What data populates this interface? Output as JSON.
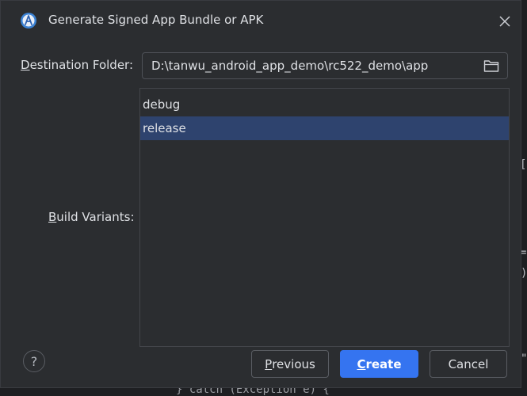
{
  "dialog": {
    "title": "Generate Signed App Bundle or APK",
    "close_icon": "close-icon",
    "app_icon": "android-studio-icon"
  },
  "destination": {
    "label_mnemonic": "D",
    "label_rest": "estination Folder:",
    "value": "D:\\tanwu_android_app_demo\\rc522_demo\\app",
    "browse_icon": "folder-icon"
  },
  "build_variants": {
    "label_mnemonic": "B",
    "label_rest": "uild Variants:",
    "items": [
      {
        "label": "debug",
        "selected": false
      },
      {
        "label": "release",
        "selected": true
      }
    ]
  },
  "buttons": {
    "help_label": "?",
    "previous_mnemonic": "P",
    "previous_rest": "revious",
    "create_mnemonic": "C",
    "create_rest": "reate",
    "cancel_label": "Cancel"
  },
  "background": {
    "bottom_code": "} catch (Exception e) {",
    "glyph_1": "[",
    "glyph_2": "=",
    "glyph_3": ")",
    "glyph_4": "\""
  },
  "colors": {
    "dialog_bg": "#2b2d30",
    "selection": "#2e436e",
    "primary_button": "#3574f0",
    "text": "#dfe1e5"
  }
}
